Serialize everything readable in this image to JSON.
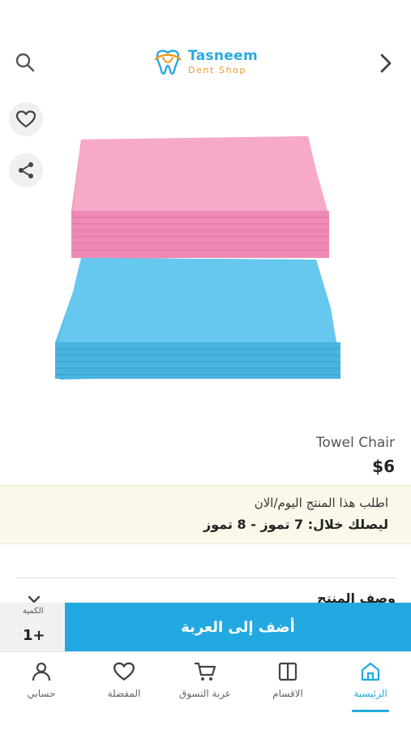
{
  "header": {
    "logo_name": "Tasneem",
    "logo_sub": "Dent Shop"
  },
  "product": {
    "name": "Towel Chair",
    "price": "$6"
  },
  "delivery": {
    "line1": "اطلب هذا المنتج اليوم/الان",
    "line2": "ليصلك خلال: 7 تموز - 8 تموز"
  },
  "description": {
    "title": "وصف المنتج"
  },
  "cart": {
    "quantity_label": "الكمية",
    "quantity_value": "1+",
    "add_label": "أضف إلى العربة"
  },
  "nav": {
    "items": [
      {
        "label": "الرئيسية",
        "icon": "home-icon",
        "active": true
      },
      {
        "label": "الاقسام",
        "icon": "categories-icon",
        "active": false
      },
      {
        "label": "عربة التسوق",
        "icon": "cart-icon",
        "active": false
      },
      {
        "label": "المفضلة",
        "icon": "heart-icon",
        "active": false
      },
      {
        "label": "حسابي",
        "icon": "user-icon",
        "active": false
      }
    ]
  },
  "colors": {
    "primary": "#22a9e1",
    "logo_orange": "#f29a1f",
    "delivery_bg": "#fbf8ea",
    "towel_pink": "#f08cb5",
    "towel_blue": "#4cb8e4"
  }
}
